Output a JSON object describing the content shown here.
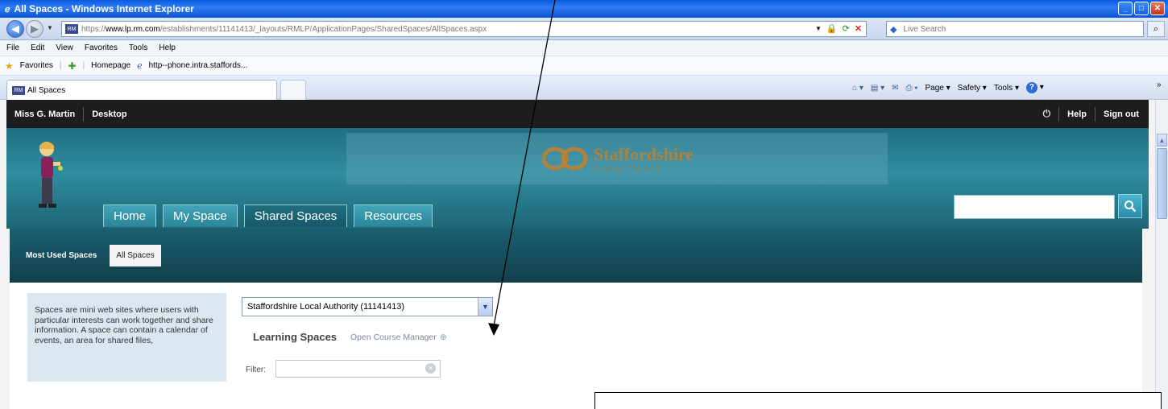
{
  "window": {
    "title": "All Spaces - Windows Internet Explorer",
    "controls": [
      "minimize",
      "maximize",
      "close"
    ]
  },
  "address": {
    "url_prefix": "https://",
    "url_domain": "www.lp.rm.com",
    "url_path": "/establishments/11141413/_layouts/RMLP/ApplicationPages/SharedSpaces/AllSpaces.aspx",
    "live_search_placeholder": "Live Search"
  },
  "menu": [
    "File",
    "Edit",
    "View",
    "Favorites",
    "Tools",
    "Help"
  ],
  "favorites_bar": {
    "favorites": "Favorites",
    "links": [
      "Homepage",
      "http--phone.intra.staffords..."
    ]
  },
  "tab": {
    "title": "All Spaces"
  },
  "command_bar": {
    "page": "Page",
    "safety": "Safety",
    "tools": "Tools"
  },
  "site": {
    "user": "Miss G. Martin",
    "desktop": "Desktop",
    "help": "Help",
    "sign_out": "Sign out",
    "logo_name": "Staffordshire",
    "logo_sub": "County Council",
    "nav": [
      "Home",
      "My Space",
      "Shared Spaces",
      "Resources"
    ],
    "active_nav_index": 2,
    "subnav": [
      "Most Used Spaces",
      "All Spaces"
    ],
    "active_subnav_index": 1
  },
  "content": {
    "info_text": "Spaces are mini web sites where users with particular interests can work together and share information. A space can contain a calendar of events, an area for shared files,",
    "authority_select": "Staffordshire Local Authority (11141413)",
    "learning_spaces": "Learning Spaces",
    "open_course_manager": "Open Course Manager",
    "filter_label": "Filter:",
    "filter_value": ""
  },
  "colors": {
    "xp_title_blue": "#0b54d3",
    "site_dark_bar": "#1d1d1d",
    "site_teal": "#2f8da0",
    "subnav_teal": "#1a5f70",
    "info_box": "#dce6f1"
  }
}
